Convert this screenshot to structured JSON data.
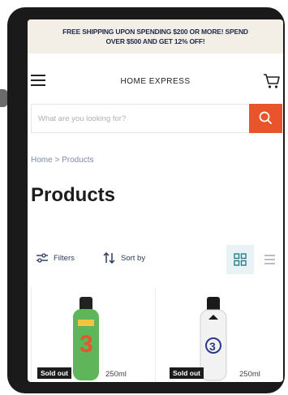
{
  "announcement": {
    "line1": "FREE SHIPPING UPON SPENDING $200 OR MORE! SPEND",
    "line2": "OVER $500 AND GET 12% OFF!"
  },
  "header": {
    "store_name": "HOME EXPRESS",
    "menu_icon": "hamburger-menu-icon",
    "cart_icon": "shopping-cart-icon"
  },
  "search": {
    "placeholder": "What are you looking for?",
    "value": "",
    "button_icon": "search-icon"
  },
  "breadcrumb": {
    "home": "Home",
    "separator": ">",
    "current": "Products"
  },
  "page": {
    "title": "Products"
  },
  "toolbar": {
    "filters_label": "Filters",
    "sortby_label": "Sort by",
    "grid_icon": "grid-view-icon",
    "list_icon": "list-view-icon"
  },
  "products": [
    {
      "badge": "Sold out",
      "volume": "250ml",
      "bottle_color": "#5fb65a",
      "cap_color": "#222222",
      "label_number": "3",
      "label_color": "#e8542c"
    },
    {
      "badge": "Sold out",
      "volume": "250ml",
      "bottle_color": "#f2f2f2",
      "cap_color": "#1a1a1a",
      "label_number": "3",
      "label_color": "#2a3a8a"
    }
  ],
  "colors": {
    "accent": "#e8542c",
    "announcement_bg": "#f3efe6",
    "grid_active_bg": "#e9f3f5",
    "link_text": "#7a8ba8"
  }
}
